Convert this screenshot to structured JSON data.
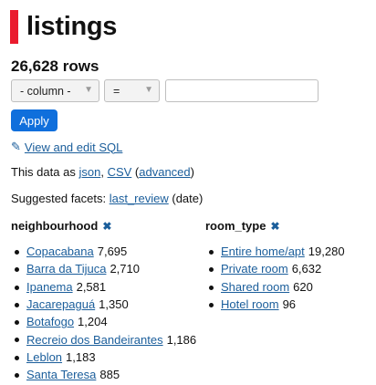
{
  "title": "listings",
  "row_count": "26,628 rows",
  "filter": {
    "column_select": "- column -",
    "operator_select": "=",
    "value": "",
    "apply_label": "Apply"
  },
  "view_sql_label": "View and edit SQL",
  "data_as": {
    "prefix": "This data as",
    "json": "json",
    "sep1": ",",
    "csv": "CSV",
    "open": "(",
    "advanced": "advanced",
    "close": ")"
  },
  "suggested": {
    "prefix": "Suggested facets:",
    "link": "last_review",
    "suffix": "(date)"
  },
  "facets": [
    {
      "name": "neighbourhood",
      "items": [
        {
          "label": "Copacabana",
          "count": "7,695"
        },
        {
          "label": "Barra da Tijuca",
          "count": "2,710"
        },
        {
          "label": "Ipanema",
          "count": "2,581"
        },
        {
          "label": "Jacarepaguá",
          "count": "1,350"
        },
        {
          "label": "Botafogo",
          "count": "1,204"
        },
        {
          "label": "Recreio dos Bandeirantes",
          "count": "1,186"
        },
        {
          "label": "Leblon",
          "count": "1,183"
        },
        {
          "label": "Santa Teresa",
          "count": "885"
        }
      ]
    },
    {
      "name": "room_type",
      "items": [
        {
          "label": "Entire home/apt",
          "count": "19,280"
        },
        {
          "label": "Private room",
          "count": "6,632"
        },
        {
          "label": "Shared room",
          "count": "620"
        },
        {
          "label": "Hotel room",
          "count": "96"
        }
      ]
    }
  ],
  "icons": {
    "pencil": "pencil-icon",
    "remove": "close-icon"
  }
}
